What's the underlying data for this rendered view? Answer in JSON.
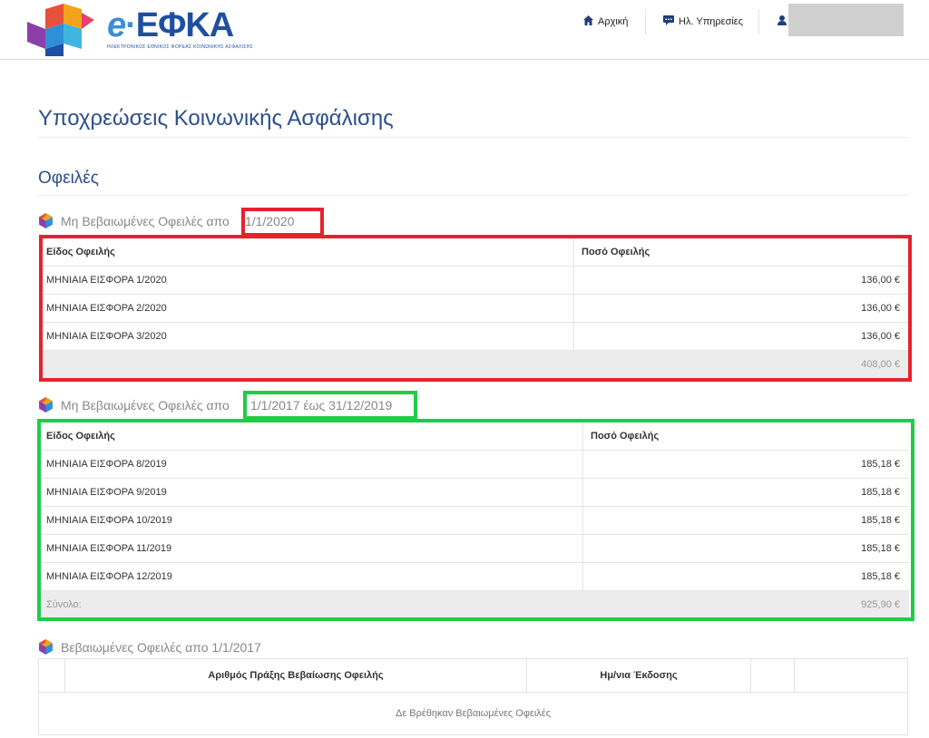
{
  "header": {
    "logo_text_e": "e",
    "logo_text_main": "ΕΦΚΑ",
    "logo_subtitle": "ΗΛΕΚΤΡΟΝΙΚΟΣ ΕΘΝΙΚΟΣ ΦΟΡΕΑΣ ΚΟΙΝΩΝΙΚΗΣ ΑΣΦΑΛΙΣΗΣ",
    "nav_home": "Αρχική",
    "nav_services": "Ηλ. Υπηρεσίες",
    "brand_color": "#1f4fa0"
  },
  "page": {
    "title": "Υποχρεώσεις Κοινωνικής Ασφάλισης",
    "section_title": "Οφειλές"
  },
  "debts1": {
    "heading": "Μη Βεβαιωμένες Οφειλές απο",
    "highlight": "1/1/2020",
    "col_type": "Είδος Οφειλής",
    "col_amount": "Ποσό Οφειλής",
    "rows": [
      {
        "type": "ΜΗΝΙΑΙΑ ΕΙΣΦΟΡΑ 1/2020",
        "amount": "136,00 €"
      },
      {
        "type": "ΜΗΝΙΑΙΑ ΕΙΣΦΟΡΑ 2/2020",
        "amount": "136,00 €"
      },
      {
        "type": "ΜΗΝΙΑΙΑ ΕΙΣΦΟΡΑ 3/2020",
        "amount": "136,00 €"
      }
    ],
    "total_label": "",
    "total": "408,00 €",
    "highlight_color": "#e5232b"
  },
  "debts2": {
    "heading": "Μη Βεβαιωμένες Οφειλές απο",
    "highlight": "1/1/2017 έως 31/12/2019",
    "col_type": "Είδος Οφειλής",
    "col_amount": "Ποσό Οφειλής",
    "rows": [
      {
        "type": "ΜΗΝΙΑΙΑ ΕΙΣΦΟΡΑ 8/2019",
        "amount": "185,18 €"
      },
      {
        "type": "ΜΗΝΙΑΙΑ ΕΙΣΦΟΡΑ 9/2019",
        "amount": "185,18 €"
      },
      {
        "type": "ΜΗΝΙΑΙΑ ΕΙΣΦΟΡΑ 10/2019",
        "amount": "185,18 €"
      },
      {
        "type": "ΜΗΝΙΑΙΑ ΕΙΣΦΟΡΑ 11/2019",
        "amount": "185,18 €"
      },
      {
        "type": "ΜΗΝΙΑΙΑ ΕΙΣΦΟΡΑ 12/2019",
        "amount": "185,18 €"
      }
    ],
    "total_label": "Σύνολο:",
    "total": "925,90 €",
    "highlight_color": "#1fcc47"
  },
  "certified": {
    "heading": "Βεβαιωμένες Οφειλές απο 1/1/2017",
    "col_act": "Αριθμός Πράξης Βεβαίωσης Οφειλής",
    "col_date": "Ημ/νια Έκδοσης",
    "empty_text": "Δε Βρέθηκαν Βεβαιωμένες Οφειλές"
  }
}
